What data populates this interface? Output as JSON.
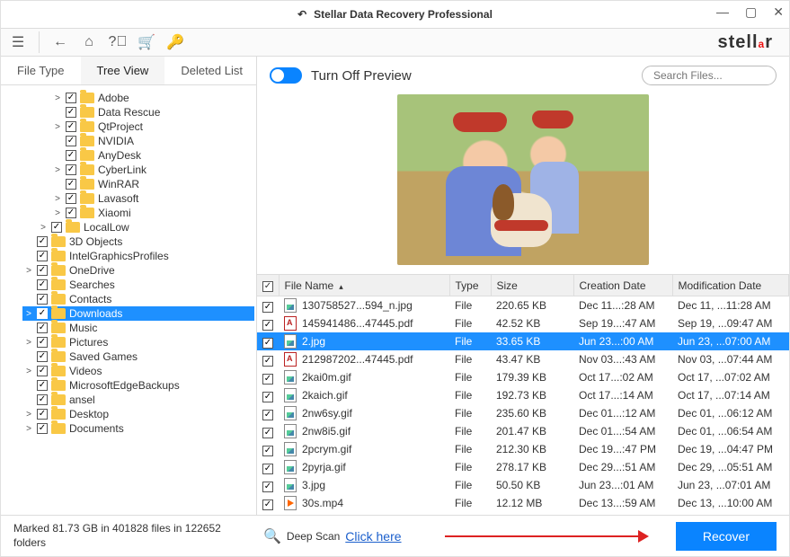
{
  "title": "Stellar Data Recovery Professional",
  "brand_text": "stellar",
  "tabs": {
    "file_type": "File Type",
    "tree_view": "Tree View",
    "deleted_list": "Deleted List"
  },
  "active_tab": "tree_view",
  "preview_toggle_label": "Turn Off Preview",
  "search_placeholder": "Search Files...",
  "tree": [
    {
      "depth": 3,
      "expander": ">",
      "checked": true,
      "label": "Adobe"
    },
    {
      "depth": 3,
      "expander": "",
      "checked": true,
      "label": "Data Rescue"
    },
    {
      "depth": 3,
      "expander": ">",
      "checked": true,
      "label": "QtProject"
    },
    {
      "depth": 3,
      "expander": "",
      "checked": true,
      "label": "NVIDIA"
    },
    {
      "depth": 3,
      "expander": "",
      "checked": true,
      "label": "AnyDesk"
    },
    {
      "depth": 3,
      "expander": ">",
      "checked": true,
      "label": "CyberLink"
    },
    {
      "depth": 3,
      "expander": "",
      "checked": true,
      "label": "WinRAR"
    },
    {
      "depth": 3,
      "expander": ">",
      "checked": true,
      "label": "Lavasoft"
    },
    {
      "depth": 3,
      "expander": ">",
      "checked": true,
      "label": "Xiaomi"
    },
    {
      "depth": 2,
      "expander": ">",
      "checked": true,
      "label": "LocalLow"
    },
    {
      "depth": 1,
      "expander": "",
      "checked": true,
      "label": "3D Objects"
    },
    {
      "depth": 1,
      "expander": "",
      "checked": true,
      "label": "IntelGraphicsProfiles"
    },
    {
      "depth": 1,
      "expander": ">",
      "checked": true,
      "label": "OneDrive"
    },
    {
      "depth": 1,
      "expander": "",
      "checked": true,
      "label": "Searches"
    },
    {
      "depth": 1,
      "expander": "",
      "checked": true,
      "label": "Contacts"
    },
    {
      "depth": 1,
      "expander": ">",
      "checked": true,
      "label": "Downloads",
      "selected": true
    },
    {
      "depth": 1,
      "expander": "",
      "checked": true,
      "label": "Music"
    },
    {
      "depth": 1,
      "expander": ">",
      "checked": true,
      "label": "Pictures"
    },
    {
      "depth": 1,
      "expander": "",
      "checked": true,
      "label": "Saved Games"
    },
    {
      "depth": 1,
      "expander": ">",
      "checked": true,
      "label": "Videos"
    },
    {
      "depth": 1,
      "expander": "",
      "checked": true,
      "label": "MicrosoftEdgeBackups"
    },
    {
      "depth": 1,
      "expander": "",
      "checked": true,
      "label": "ansel"
    },
    {
      "depth": 1,
      "expander": ">",
      "checked": true,
      "label": "Desktop"
    },
    {
      "depth": 1,
      "expander": ">",
      "checked": true,
      "label": "Documents"
    }
  ],
  "columns": {
    "name": "File Name",
    "type": "Type",
    "size": "Size",
    "cdate": "Creation Date",
    "mdate": "Modification Date"
  },
  "files": [
    {
      "icon": "img",
      "name": "130758527...594_n.jpg",
      "type": "File",
      "size": "220.65 KB",
      "cdate": "Dec 11...:28 AM",
      "mdate": "Dec 11, ...11:28 AM"
    },
    {
      "icon": "pdf",
      "name": "145941486...47445.pdf",
      "type": "File",
      "size": "42.52 KB",
      "cdate": "Sep 19...:47 AM",
      "mdate": "Sep 19, ...09:47 AM"
    },
    {
      "icon": "img",
      "name": "2.jpg",
      "type": "File",
      "size": "33.65 KB",
      "cdate": "Jun 23...:00 AM",
      "mdate": "Jun 23, ...07:00 AM",
      "selected": true
    },
    {
      "icon": "pdf",
      "name": "212987202...47445.pdf",
      "type": "File",
      "size": "43.47 KB",
      "cdate": "Nov 03...:43 AM",
      "mdate": "Nov 03, ...07:44 AM"
    },
    {
      "icon": "img",
      "name": "2kai0m.gif",
      "type": "File",
      "size": "179.39 KB",
      "cdate": "Oct 17...:02 AM",
      "mdate": "Oct 17, ...07:02 AM"
    },
    {
      "icon": "img",
      "name": "2kaich.gif",
      "type": "File",
      "size": "192.73 KB",
      "cdate": "Oct 17...:14 AM",
      "mdate": "Oct 17, ...07:14 AM"
    },
    {
      "icon": "img",
      "name": "2nw6sy.gif",
      "type": "File",
      "size": "235.60 KB",
      "cdate": "Dec 01...:12 AM",
      "mdate": "Dec 01, ...06:12 AM"
    },
    {
      "icon": "img",
      "name": "2nw8i5.gif",
      "type": "File",
      "size": "201.47 KB",
      "cdate": "Dec 01...:54 AM",
      "mdate": "Dec 01, ...06:54 AM"
    },
    {
      "icon": "img",
      "name": "2pcrym.gif",
      "type": "File",
      "size": "212.30 KB",
      "cdate": "Dec 19...:47 PM",
      "mdate": "Dec 19, ...04:47 PM"
    },
    {
      "icon": "img",
      "name": "2pyrja.gif",
      "type": "File",
      "size": "278.17 KB",
      "cdate": "Dec 29...:51 AM",
      "mdate": "Dec 29, ...05:51 AM"
    },
    {
      "icon": "img",
      "name": "3.jpg",
      "type": "File",
      "size": "50.50 KB",
      "cdate": "Jun 23...:01 AM",
      "mdate": "Jun 23, ...07:01 AM"
    },
    {
      "icon": "vid",
      "name": "30s.mp4",
      "type": "File",
      "size": "12.12 MB",
      "cdate": "Dec 13...:59 AM",
      "mdate": "Dec 13, ...10:00 AM"
    }
  ],
  "status": "Marked 81.73 GB in 401828 files in 122652 folders",
  "deepscan_label": "Deep Scan",
  "deepscan_link": "Click here",
  "recover_label": "Recover"
}
